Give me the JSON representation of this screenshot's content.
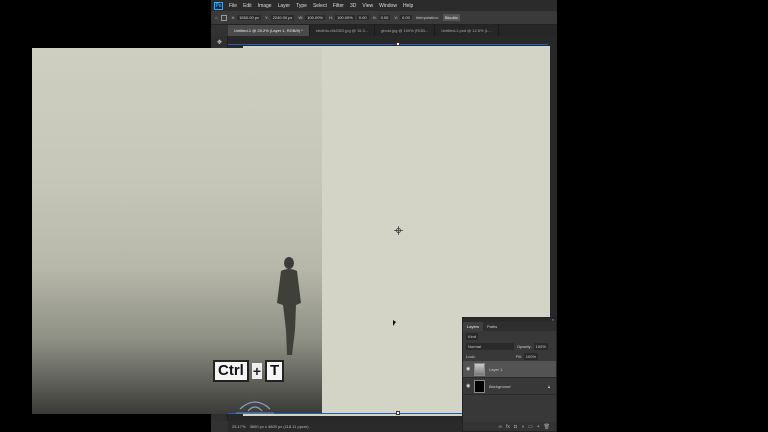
{
  "app": {
    "logo": "Ps"
  },
  "menu": [
    "File",
    "Edit",
    "Image",
    "Layer",
    "Type",
    "Select",
    "Filter",
    "3D",
    "View",
    "Window",
    "Help"
  ],
  "options": {
    "x_label": "X:",
    "x_value": "1550.00 px",
    "y_label": "Y:",
    "y_value": "2240.00 px",
    "w_label": "W:",
    "w_value": "100.00%",
    "h_label": "H:",
    "h_value": "100.00%",
    "angle_value": "0.00",
    "h_skew_label": "H:",
    "h_skew_value": "0.00",
    "v_skew_label": "V:",
    "v_skew_value": "0.00",
    "interpolation_label": "Interpolation:",
    "interpolation_value": "Bicubic"
  },
  "tabs": [
    {
      "label": "Untitled-1 @ 25.2% (Layer 1, RGB/8) *",
      "active": true
    },
    {
      "label": "struthio-r6kG5O.jpg @ 15.3...",
      "active": false
    },
    {
      "label": "ghost.jpg @ 100% (RGB...",
      "active": false
    },
    {
      "label": "Untitled-1.psd @ 12.5% (L...",
      "active": false
    }
  ],
  "tools": [
    "move-tool",
    "marquee-tool",
    "lasso-tool",
    "quick-select-tool",
    "crop-tool",
    "frame-tool",
    "eyedropper-tool",
    "healing-tool",
    "brush-tool",
    "stamp-tool",
    "history-brush-tool",
    "eraser-tool",
    "gradient-tool",
    "blur-tool",
    "dodge-tool",
    "pen-tool",
    "type-tool",
    "path-select-tool",
    "shape-tool",
    "hand-tool",
    "zoom-tool",
    "more-tools"
  ],
  "status": {
    "zoom": "25.17%",
    "doc_size": "3600 px x 4800 px (118.11 ppcm)"
  },
  "overlay_keys": {
    "key1": "Ctrl",
    "plus": "+",
    "key2": "T"
  },
  "layers_panel": {
    "tabs": [
      "Layers",
      "Paths"
    ],
    "kind_label": "Kind",
    "blend_mode": "Normal",
    "opacity_label": "Opacity:",
    "opacity_value": "100%",
    "lock_label": "Lock:",
    "fill_label": "Fill:",
    "fill_value": "100%",
    "layers": [
      {
        "name": "Layer 1",
        "selected": true
      },
      {
        "name": "Background",
        "selected": false
      }
    ]
  },
  "colors": {
    "accent": "#31a8ff",
    "selection": "#1e5fb8",
    "panel_bg": "#383838"
  }
}
